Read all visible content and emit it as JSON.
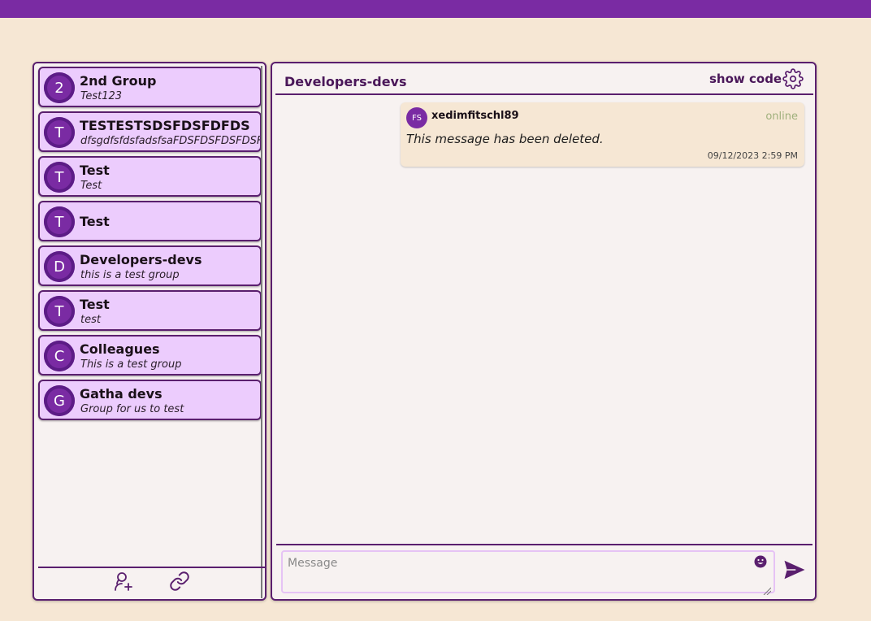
{
  "groups": [
    {
      "initial": "2",
      "name": "2nd Group",
      "description": "Test123"
    },
    {
      "initial": "T",
      "name": "TESTESTSDSFDSFDFDS",
      "description": "dfsgdfsfdsfadsfsaFDSFDSFDSFDSFDSFSD"
    },
    {
      "initial": "T",
      "name": "Test",
      "description": "Test"
    },
    {
      "initial": "T",
      "name": "Test",
      "description": ""
    },
    {
      "initial": "D",
      "name": "Developers-devs",
      "description": "this is a test group"
    },
    {
      "initial": "T",
      "name": "Test",
      "description": "test"
    },
    {
      "initial": "C",
      "name": "Colleagues",
      "description": "This is a test group"
    },
    {
      "initial": "G",
      "name": "Gatha devs",
      "description": "Group for us to test"
    }
  ],
  "sidebar_footer": {
    "icons": [
      "add-user-icon",
      "link-icon"
    ]
  },
  "chat": {
    "title": "Developers-devs",
    "show_code_label": "show code",
    "settings_icon": "gear-icon"
  },
  "message": {
    "avatar_initials": "FS",
    "username": "xedimfitschl89",
    "status": "online",
    "text": "This message has been deleted.",
    "timestamp": "09/12/2023 2:59 PM"
  },
  "composer": {
    "placeholder": "Message",
    "emoji_icon": "emoji-icon",
    "send_icon": "send-icon"
  },
  "colors": {
    "accent": "#7a2ba3",
    "dark_accent": "#5a1f6e",
    "group_card": "#ecccfd",
    "background": "#f6e7d4",
    "panel": "#f7f2f1",
    "status_online": "#9fb07c"
  }
}
